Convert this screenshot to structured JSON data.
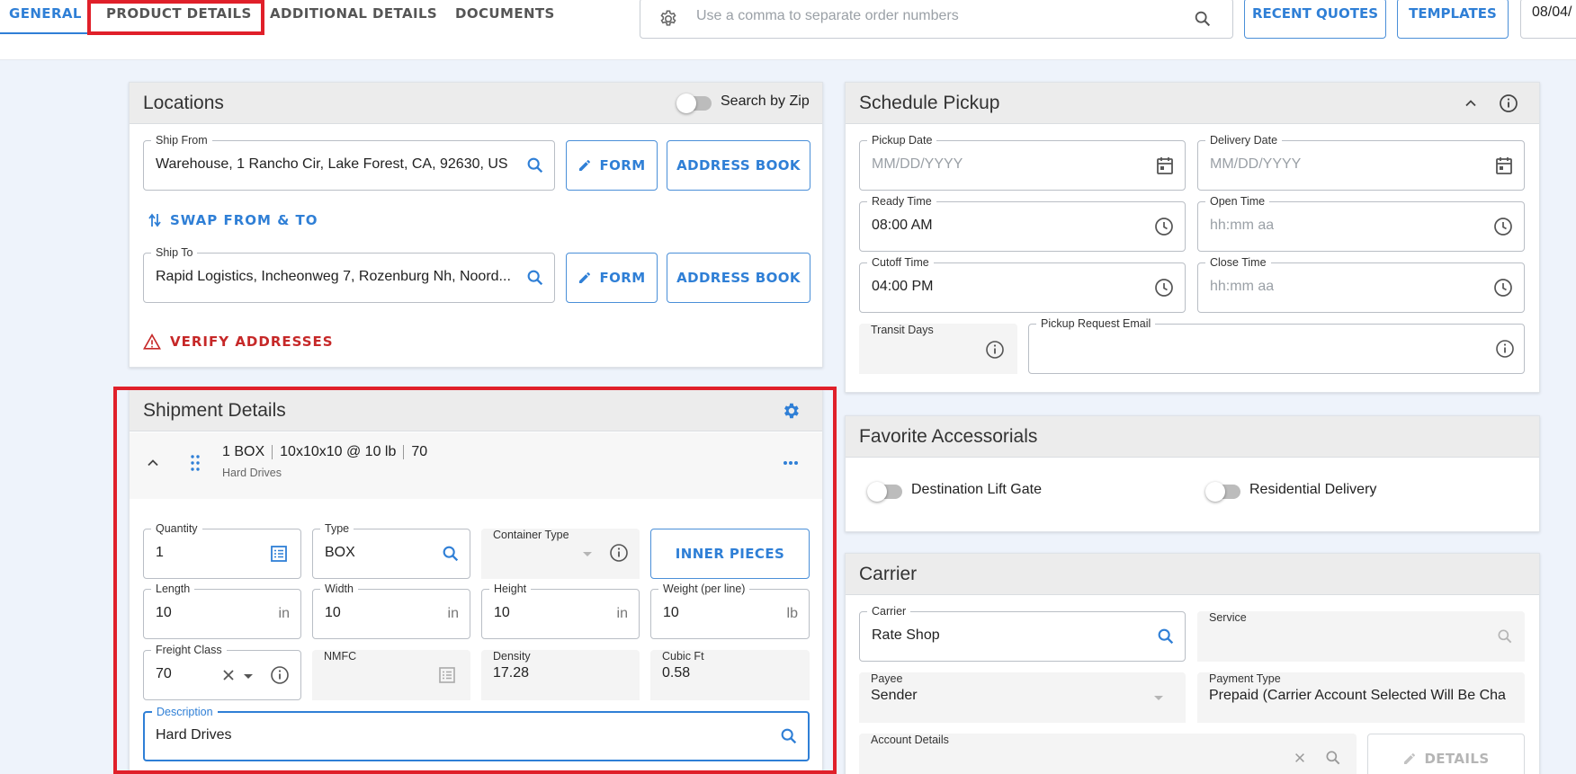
{
  "tabs": [
    {
      "label": "GENERAL",
      "active": true
    },
    {
      "label": "PRODUCT DETAILS"
    },
    {
      "label": "ADDITIONAL DETAILS"
    },
    {
      "label": "DOCUMENTS"
    }
  ],
  "search": {
    "placeholder": "Use a comma to separate order numbers"
  },
  "top_buttons": {
    "recent_quotes": "RECENT QUOTES",
    "templates": "TEMPLATES"
  },
  "date_chip": "08/04/",
  "locations": {
    "title": "Locations",
    "search_by_zip": "Search by Zip",
    "ship_from": {
      "label": "Ship From",
      "value": "Warehouse, 1 Rancho Cir, Lake Forest, CA, 92630, US"
    },
    "ship_to": {
      "label": "Ship To",
      "value": "Rapid Logistics, Incheonweg 7, Rozenburg Nh, Noord..."
    },
    "form_label": "FORM",
    "address_book_label": "ADDRESS BOOK",
    "swap_label": "SWAP FROM & TO",
    "verify_label": "VERIFY ADDRESSES"
  },
  "shipment": {
    "title": "Shipment Details",
    "summary": {
      "qty_type": "1 BOX",
      "dims": "10x10x10 @ 10 lb",
      "class": "70",
      "desc": "Hard Drives"
    },
    "quantity": {
      "label": "Quantity",
      "value": "1"
    },
    "type": {
      "label": "Type",
      "value": "BOX"
    },
    "container_type": {
      "label": "Container Type",
      "value": ""
    },
    "inner_pieces": "INNER PIECES",
    "length": {
      "label": "Length",
      "value": "10",
      "unit": "in"
    },
    "width": {
      "label": "Width",
      "value": "10",
      "unit": "in"
    },
    "height": {
      "label": "Height",
      "value": "10",
      "unit": "in"
    },
    "weight": {
      "label": "Weight (per line)",
      "value": "10",
      "unit": "lb"
    },
    "freight_class": {
      "label": "Freight Class",
      "value": "70"
    },
    "nmfc": {
      "label": "NMFC",
      "value": ""
    },
    "density": {
      "label": "Density",
      "value": "17.28"
    },
    "cubic_ft": {
      "label": "Cubic Ft",
      "value": "0.58"
    },
    "description": {
      "label": "Description",
      "value": "Hard Drives"
    }
  },
  "schedule": {
    "title": "Schedule Pickup",
    "pickup_date": {
      "label": "Pickup Date",
      "placeholder": "MM/DD/YYYY"
    },
    "delivery_date": {
      "label": "Delivery Date",
      "placeholder": "MM/DD/YYYY"
    },
    "ready_time": {
      "label": "Ready Time",
      "value": "08:00 AM"
    },
    "open_time": {
      "label": "Open Time",
      "placeholder": "hh:mm aa"
    },
    "cutoff_time": {
      "label": "Cutoff Time",
      "value": "04:00 PM"
    },
    "close_time": {
      "label": "Close Time",
      "placeholder": "hh:mm aa"
    },
    "transit_days": {
      "label": "Transit Days",
      "value": ""
    },
    "pickup_email": {
      "label": "Pickup Request Email",
      "value": ""
    }
  },
  "accessorials": {
    "title": "Favorite Accessorials",
    "items": [
      "Destination Lift Gate",
      "Residential Delivery"
    ]
  },
  "carrier": {
    "title": "Carrier",
    "carrier": {
      "label": "Carrier",
      "value": "Rate Shop"
    },
    "service": {
      "label": "Service",
      "value": ""
    },
    "payee": {
      "label": "Payee",
      "value": "Sender"
    },
    "payment_type": {
      "label": "Payment Type",
      "value": "Prepaid (Carrier Account Selected Will Be Cha"
    },
    "account_details": {
      "label": "Account Details",
      "value": ""
    },
    "details_label": "DETAILS"
  },
  "colors": {
    "accent": "#2f7fd6",
    "danger": "#c62828",
    "highlight": "#e0202a"
  }
}
